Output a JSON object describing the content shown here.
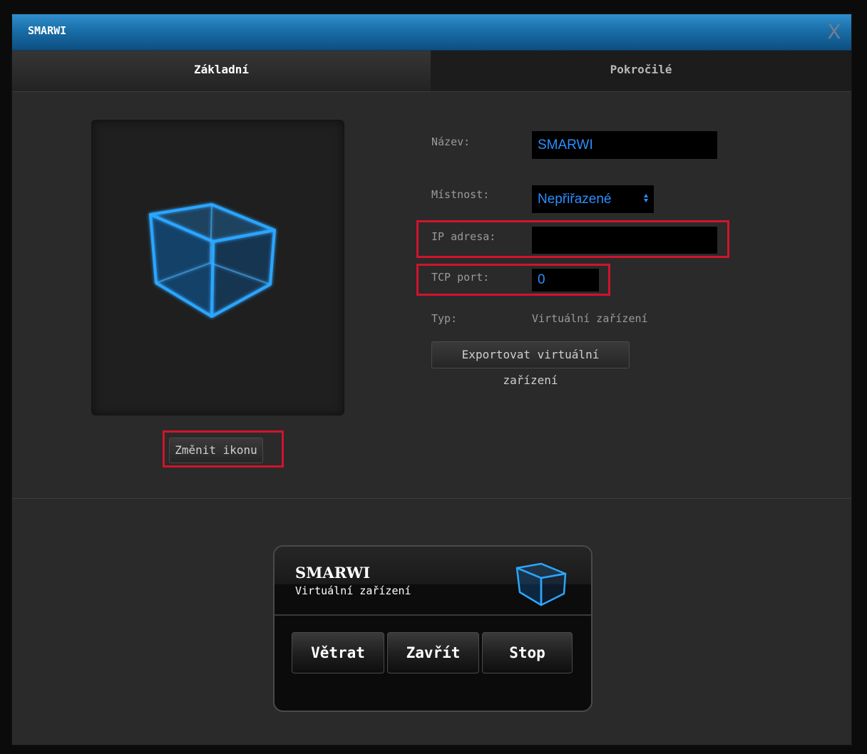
{
  "window": {
    "title": "SMARWI",
    "close_label": "X"
  },
  "tabs": [
    {
      "label": "Základní",
      "active": true
    },
    {
      "label": "Pokročilé",
      "active": false
    }
  ],
  "icon_panel": {
    "icon": "cube-icon",
    "change_button": "Změnit ikonu"
  },
  "form": {
    "name_label": "Název:",
    "name_value": "SMARWI",
    "room_label": "Místnost:",
    "room_value": "Nepřiřazené",
    "ip_label": "IP adresa:",
    "ip_value": "",
    "port_label": "TCP port:",
    "port_value": "0",
    "type_label": "Typ:",
    "type_value": "Virtuální zařízení",
    "export_button": "Exportovat virtuální zařízení"
  },
  "widget": {
    "name": "SMARWI",
    "type": "Virtuální zařízení",
    "icon": "cube-icon",
    "buttons": [
      "Větrat",
      "Zavřít",
      "Stop"
    ]
  },
  "colors": {
    "titlebar": "#1a6ea8",
    "input_text": "#2a8fff",
    "highlight": "#d0142c"
  }
}
